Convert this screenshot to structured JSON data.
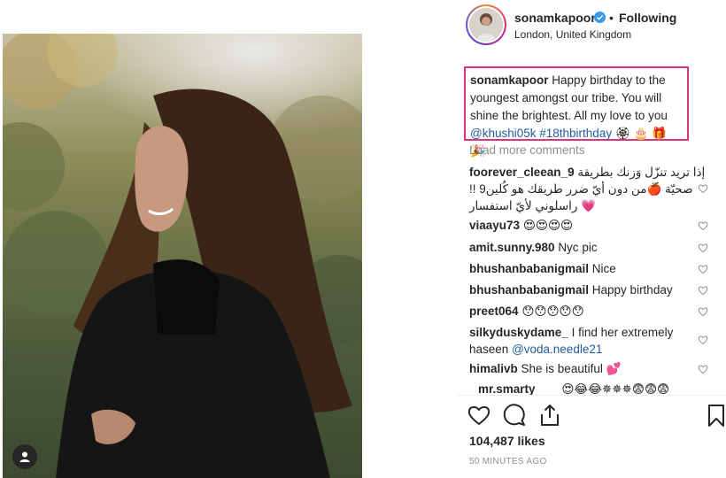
{
  "header": {
    "username": "sonamkapoor",
    "separator": "•",
    "follow_status": "Following",
    "location": "London, United Kingdom"
  },
  "caption": {
    "username": "sonamkapoor",
    "text": "Happy birthday to the youngest amongst our tribe. You will shine the brightest. All my love to you",
    "mention": "@khushi05k",
    "hashtag": "#18thbirthday",
    "emojis": "🏵 🎂 🎁 🎉"
  },
  "load_more": "Load more comments",
  "comments": [
    {
      "user": "foorever_cleean_9",
      "text": "إذا تريد تنزّل وَزنك بطريقة صحيّة 🍎من دون أيّ ضرر طريقك هو كُلين9 !! 💗 راسلوني لأيّ استفسار"
    },
    {
      "user": "viaayu73",
      "text": "😍😍😍😍"
    },
    {
      "user": "amit.sunny.980",
      "text": "Nyc pic"
    },
    {
      "user": "bhushanbabanigmail",
      "text": "Nice"
    },
    {
      "user": "bhushanbabanigmail",
      "text": "Happy birthday"
    },
    {
      "user": "preet064",
      "text": "😯😯😯😯😯"
    },
    {
      "user": "silkyduskydame_",
      "text": "I find her extremely haseen",
      "mention": "@voda.needle21"
    },
    {
      "user": "himalivb",
      "text": "She is beautiful 💕"
    },
    {
      "user": "mr.smarty",
      "text": "😍😂😂✵✵✵😨😨😨"
    }
  ],
  "likes": "104,487 likes",
  "timestamp": "50 MINUTES AGO",
  "colors": {
    "highlight_border": "#e0337f",
    "link": "#1f5c9e",
    "verified": "#3897f0",
    "muted": "#8e8e8e"
  },
  "icons": [
    "user-tag-icon",
    "verified-badge-icon",
    "heart-icon",
    "comment-icon",
    "share-icon",
    "bookmark-icon"
  ]
}
